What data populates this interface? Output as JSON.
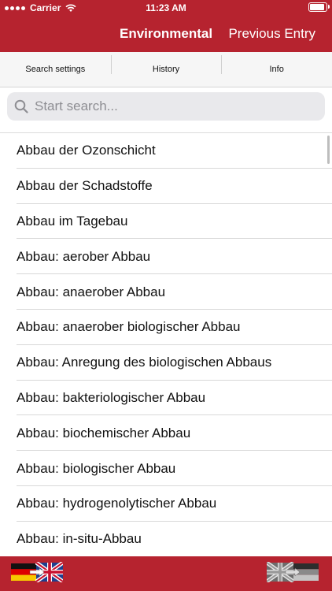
{
  "status_bar": {
    "carrier": "Carrier",
    "time": "11:23 AM"
  },
  "nav": {
    "title": "Environmental",
    "right_button": "Previous Entry"
  },
  "segments": [
    "Search settings",
    "History",
    "Info"
  ],
  "search": {
    "placeholder": "Start search..."
  },
  "entries": [
    "Abbau der Ozonschicht",
    "Abbau der Schadstoffe",
    "Abbau im Tagebau",
    "Abbau: aerober Abbau",
    "Abbau: anaerober Abbau",
    "Abbau: anaerober biologischer Abbau",
    "Abbau: Anregung des biologischen Abbaus",
    "Abbau: bakteriologischer Abbau",
    "Abbau: biochemischer Abbau",
    "Abbau: biologischer Abbau",
    "Abbau: hydrogenolytischer Abbau",
    "Abbau: in-situ-Abbau"
  ],
  "bottom_bar": {
    "left_icon": "flag-de-to-en-icon",
    "right_icon": "flag-en-to-de-icon"
  },
  "colors": {
    "brand_red": "#b6232f",
    "search_bg": "#e9e9ec",
    "segment_bg": "#f6f6f6"
  }
}
